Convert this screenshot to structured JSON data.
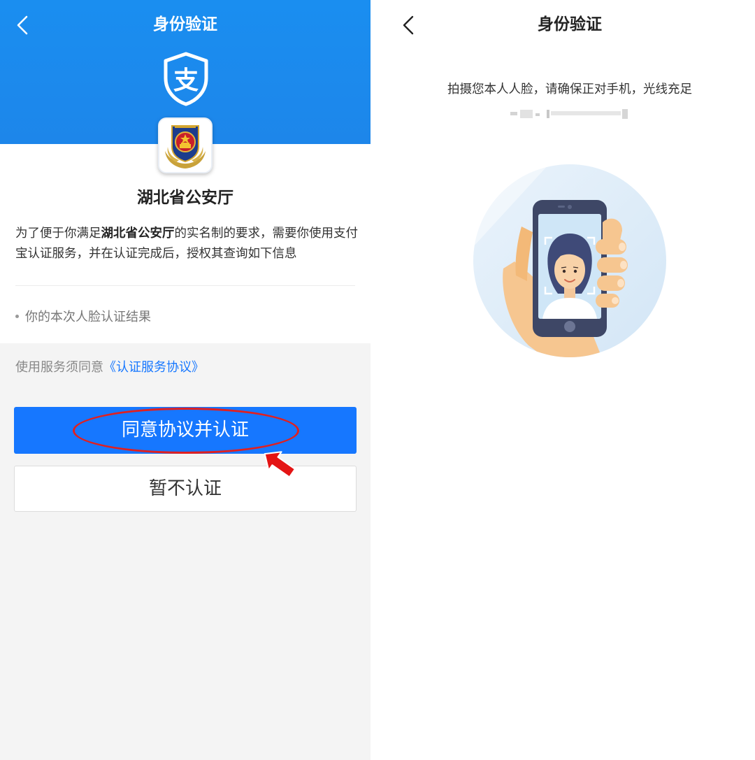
{
  "left_screen": {
    "title": "身份验证",
    "back_icon": "chevron-left-icon",
    "brand_icon": "alipay-shield-icon",
    "org_logo": "police-emblem-icon",
    "org_name": "湖北省公安厅",
    "description": {
      "part1": "为了便于你满足",
      "org_bold": "湖北省公安厅",
      "part2": "的实名制的要求，需要你使用支付宝认证服务，并在认证完成后，授权其查询如下信息"
    },
    "info_items": [
      "你的本次人脸认证结果"
    ],
    "agreement_prefix": "使用服务须同意",
    "agreement_link": "《认证服务协议》",
    "primary_button": "同意协议并认证",
    "secondary_button": "暂不认证",
    "colors": {
      "header_blue": "#1a8ef0",
      "button_blue": "#1677ff",
      "annotation_red": "#e02020"
    }
  },
  "right_screen": {
    "title": "身份验证",
    "back_icon": "chevron-left-icon",
    "instruction": "拍摄您本人人脸，请确保正对手机，光线充足",
    "masked_name": "",
    "illustration": "face-scan-phone-illustration"
  }
}
